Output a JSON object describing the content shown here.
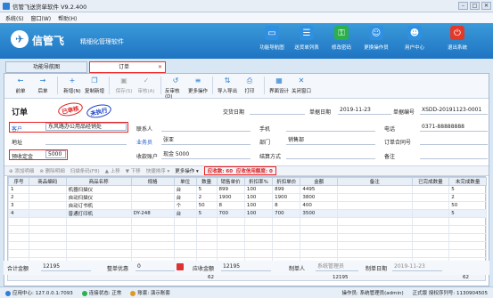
{
  "window": {
    "title": "信管飞送货单软件 V9.2.400"
  },
  "menu": [
    "系统(S)",
    "窗口(W)",
    "帮助(H)"
  ],
  "banner": {
    "logo_text": "信管飞",
    "slogan": "精细化管理软件",
    "buttons": [
      {
        "label": "功能导航图",
        "icon": "monitor-icon",
        "color": "#2f8fe0"
      },
      {
        "label": "送货单列表",
        "icon": "list-icon",
        "color": "#2f8fe0"
      },
      {
        "label": "修改密码",
        "icon": "key-icon",
        "color": "#2bb04a"
      },
      {
        "label": "更换操作员",
        "icon": "users-icon",
        "color": "#2f8fe0"
      },
      {
        "label": "用户中心",
        "icon": "user-icon",
        "color": "#2f8fe0"
      },
      {
        "label": "退出系统",
        "icon": "power-icon",
        "color": "#e23a2a"
      }
    ]
  },
  "tabs": [
    {
      "label": "功能导航图",
      "active": false
    },
    {
      "label": "订单",
      "active": true
    }
  ],
  "toolbar": [
    {
      "label": "前单",
      "icon": "←"
    },
    {
      "label": "后单",
      "icon": "→"
    },
    {
      "label": "新增(N)",
      "icon": "+"
    },
    {
      "label": "复制新增",
      "icon": "❐"
    },
    {
      "label": "保存(S)",
      "icon": "▣",
      "disabled": true
    },
    {
      "label": "审核(A)",
      "icon": "✓",
      "disabled": true
    },
    {
      "label": "反审核(D)",
      "icon": "↺"
    },
    {
      "label": "更多操作",
      "icon": "≡"
    },
    {
      "label": "导入导出",
      "icon": "⇅"
    },
    {
      "label": "打印",
      "icon": "⎙"
    },
    {
      "label": "界面设计",
      "icon": "▦"
    },
    {
      "label": "关闭窗口",
      "icon": "✕"
    }
  ],
  "form": {
    "title": "订单",
    "stamp_approved": "已审核",
    "stamp_pending": "未执行",
    "labels": {
      "delivery_date": "交货日期",
      "doc_date": "单据日期",
      "doc_no": "单据编号",
      "customer": "客户",
      "contact": "联系人",
      "mobile": "手机",
      "phone": "电话",
      "address": "地址",
      "salesman": "业务员",
      "dept": "部门",
      "contract_no": "订单合同号",
      "deposit": "预收定金",
      "account": "收款账户",
      "settle": "结算方式",
      "remark": "备注"
    },
    "values": {
      "delivery_date": "",
      "doc_date": "2019-11-23",
      "doc_no": "XSDD-20191123-0001",
      "customer": "东风路办公用品经销处",
      "contact": "",
      "mobile": "",
      "phone": "0371-88888888",
      "address": "",
      "salesman": "张亚",
      "dept": "销售部",
      "contract_no": "",
      "deposit": "5000",
      "account": "现金 5000",
      "settle": "",
      "remark": ""
    }
  },
  "grid_toolbar": {
    "add_row": "添加明细",
    "del_row": "删除明细",
    "scan": "扫描条码(F8)",
    "up": "上移",
    "down": "下移",
    "quick_sort": "快捷排序",
    "more": "更多操作",
    "receivable": "应收款: 60",
    "credit": "应收信用额度: 0"
  },
  "table": {
    "headers": [
      "序号",
      "商品编码",
      "商品名称",
      "规格",
      "单位",
      "数量",
      "销售单价",
      "折扣率%",
      "折扣单价",
      "金额",
      "备注",
      "已完成数量",
      "未完成数量"
    ],
    "rows": [
      [
        "1",
        "",
        "机器扫描仪",
        "",
        "台",
        "5",
        "899",
        "100",
        "899",
        "4495",
        "",
        "",
        "5"
      ],
      [
        "2",
        "",
        "自动扫描仪",
        "",
        "台",
        "2",
        "1900",
        "100",
        "1900",
        "3800",
        "",
        "",
        "2"
      ],
      [
        "3",
        "",
        "自动订书机",
        "",
        "个",
        "50",
        "8",
        "100",
        "8",
        "400",
        "",
        "",
        "50"
      ],
      [
        "4",
        "",
        "普通打印机",
        "DY-248",
        "台",
        "5",
        "700",
        "100",
        "700",
        "3500",
        "",
        "",
        "5"
      ]
    ],
    "sum_qty": "62",
    "sum_amount": "12195",
    "sum_unfinished": "62"
  },
  "footer": {
    "total_label": "合计金额",
    "total": "12195",
    "discount_label": "整单优惠",
    "discount": "0",
    "receivable_label": "应收金额",
    "receivable": "12195",
    "maker_label": "制单人",
    "maker": "系统管理员",
    "make_date_label": "制单日期",
    "make_date": "2019-11-23"
  },
  "status": {
    "app_center": "应用中心: 127.0.0.1:7093",
    "connection": "连接状态: 正常",
    "account": "账套: 演示账套",
    "operator": "操作员: 系统管理员(admin)",
    "license": "正式版 授权序列号: 1130904505"
  }
}
